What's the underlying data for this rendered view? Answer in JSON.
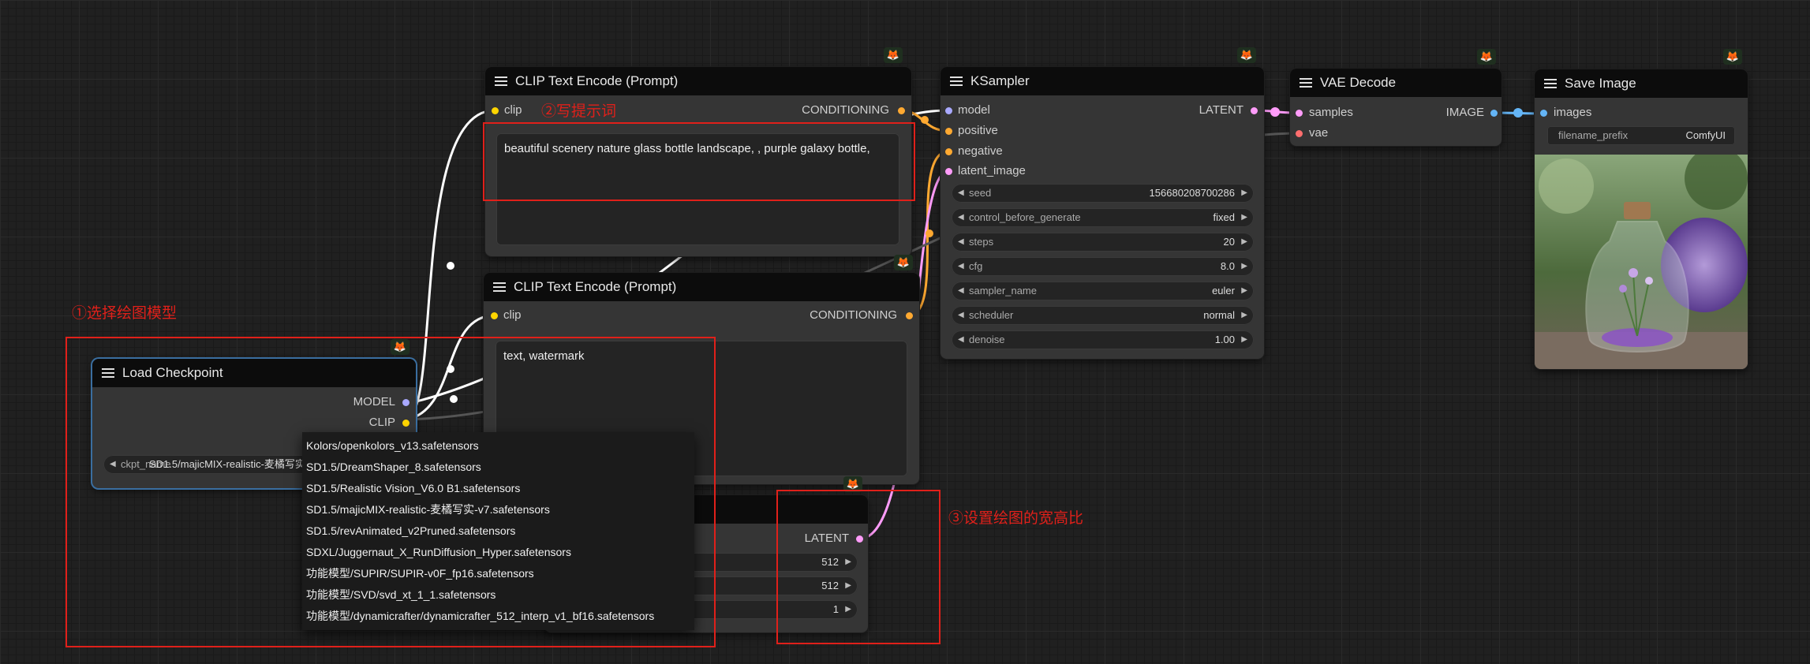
{
  "nodes": {
    "clip_pos": {
      "title": "CLIP Text Encode (Prompt)",
      "input_clip": "clip",
      "output": "CONDITIONING",
      "text": "beautiful scenery nature glass bottle landscape, , purple galaxy bottle,"
    },
    "clip_neg": {
      "title": "CLIP Text Encode (Prompt)",
      "input_clip": "clip",
      "output": "CONDITIONING",
      "text": "text, watermark"
    },
    "load_ckpt": {
      "title": "Load Checkpoint",
      "out_model": "MODEL",
      "out_clip": "CLIP",
      "widget_label": "ckpt_name",
      "widget_value": "SD1.5/majicMIX-realistic-麦橘写实"
    },
    "latent": {
      "output": "LATENT",
      "widgets": [
        "512",
        "512",
        "1"
      ]
    },
    "ksampler": {
      "title": "KSampler",
      "inputs": [
        "model",
        "positive",
        "negative",
        "latent_image"
      ],
      "output": "LATENT",
      "widgets": [
        {
          "label": "seed",
          "value": "156680208700286"
        },
        {
          "label": "control_before_generate",
          "value": "fixed"
        },
        {
          "label": "steps",
          "value": "20"
        },
        {
          "label": "cfg",
          "value": "8.0"
        },
        {
          "label": "sampler_name",
          "value": "euler"
        },
        {
          "label": "scheduler",
          "value": "normal"
        },
        {
          "label": "denoise",
          "value": "1.00"
        }
      ]
    },
    "vae_decode": {
      "title": "VAE Decode",
      "in_samples": "samples",
      "in_vae": "vae",
      "output": "IMAGE"
    },
    "save_image": {
      "title": "Save Image",
      "in_images": "images",
      "widget_label": "filename_prefix",
      "widget_value": "ComfyUI"
    }
  },
  "dropdown": [
    "Kolors/openkolors_v13.safetensors",
    "SD1.5/DreamShaper_8.safetensors",
    "SD1.5/Realistic Vision_V6.0 B1.safetensors",
    "SD1.5/majicMIX-realistic-麦橘写实-v7.safetensors",
    "SD1.5/revAnimated_v2Pruned.safetensors",
    "SDXL/Juggernaut_X_RunDiffusion_Hyper.safetensors",
    "功能模型/SUPIR/SUPIR-v0F_fp16.safetensors",
    "功能模型/SVD/svd_xt_1_1.safetensors",
    "功能模型/dynamicrafter/dynamicrafter_512_interp_v1_bf16.safetensors"
  ],
  "annotations": {
    "a1": "①选择绘图模型",
    "a2": "②写提示词",
    "a3": "③设置绘图的宽高比"
  },
  "colors": {
    "model": "#a9a9ff",
    "clip": "#ffd500",
    "conditioning": "#ffa931",
    "latent": "#ff9cf9",
    "vae": "#ff6e6e",
    "image": "#64b5f6",
    "annotation": "#e0201a"
  },
  "icons": {
    "node_badge": "fox-icon",
    "node_menu": "hamburger-menu-icon"
  }
}
